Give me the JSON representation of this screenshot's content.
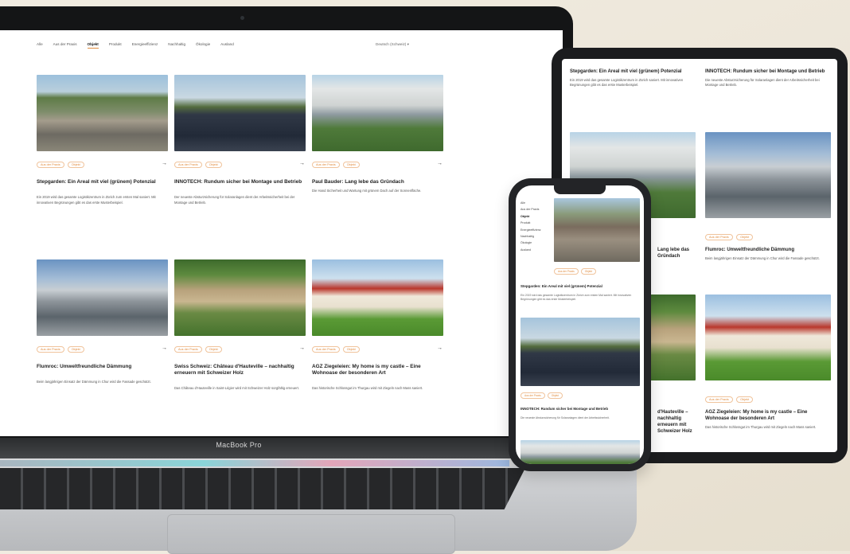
{
  "laptop": {
    "label": "MacBook Pro",
    "nav": [
      "Alle",
      "Aus der Praxis",
      "Objekt",
      "Produkt",
      "Energieeffizienz",
      "Nachhaltig",
      "Ökologie",
      "Ausland"
    ],
    "nav_active_index": 2,
    "language": "Deutsch (Schweiz) ▾",
    "cards": [
      {
        "title": "Stepgarden: Ein Areal mit viel (grünem) Potenzial",
        "text": "Ein 2019 wird das gesamte Logistikzentrum in Zürich zum ersten Mal saniert. Mit innovativen Begrünungen gibt es das erste Musterbeispiel.",
        "tags": [
          "Aus der Praxis",
          "Objekt"
        ]
      },
      {
        "title": "INNOTECH: Rundum sicher bei Montage und Betrieb",
        "text": "Der neueste Absturzsicherung für Solaranlagen dient der Arbeitssicherheit bei der Montage und Betrieb.",
        "tags": [
          "Aus der Praxis",
          "Objekt"
        ]
      },
      {
        "title": "Paul Bauder: Lang lebe das Gründach",
        "text": "Die Hand Sicherheit und Wartung mit grünem Dach auf der Sonnenfläche.",
        "tags": [
          "Aus der Praxis",
          "Objekt"
        ]
      },
      {
        "title": "Flumroc: Umweltfreundliche Dämmung",
        "text": "Beim langjährigen Einsatz der Dämmung in Chur wird die Fassade geschützt.",
        "tags": [
          "Aus der Praxis",
          "Objekt"
        ]
      },
      {
        "title": "Swiss Schweiz: Château d'Hauteville – nachhaltig erneuern mit Schweizer Holz",
        "text": "Das Château d'Hauteville in Saint-Légier wird mit Schweizer Holz sorgfältig erneuert.",
        "tags": [
          "Aus der Praxis",
          "Objekt"
        ]
      },
      {
        "title": "AGZ Ziegeleien: My home is my castle – Eine Wohnoase der besonderen Art",
        "text": "Das historische Schlossgut im Thurgau wird mit Ziegeln nach Mass saniert.",
        "tags": [
          "Aus der Praxis",
          "Objekt"
        ]
      }
    ]
  },
  "tablet": {
    "left_title": "Stepgarden: Ein Areal mit viel (grünem) Potenzial",
    "left_text": "Ein 2019 wird das gesamte Logistikzentrum in Zürich saniert. Mit innovativen Begrünungen gibt es das erste Musterbeispiel.",
    "right_title": "INNOTECH: Rundum sicher bei Montage und Betrieb",
    "right_text": "Die neueste Absturzsicherung für Solaranlagen dient der Arbeitssicherheit bei Montage und Betrieb.",
    "mid_left_title": "Lang lebe das Gründach",
    "mid_right_title": "Flumroc: Umweltfreundliche Dämmung",
    "mid_right_text": "Beim langjährigen Einsatz der Dämmung in Chur wird die Fassade geschützt.",
    "low_left_title": "d'Hauteville – nachhaltig erneuern mit Schweizer Holz",
    "low_right_title": "AGZ Ziegeleien: My home is my castle – Eine Wohnoase der besonderen Art",
    "low_right_text": "Das historische Schlossgut im Thurgau wird mit Ziegeln nach Mass saniert.",
    "tags": [
      "Aus der Praxis",
      "Objekt"
    ]
  },
  "phone": {
    "nav": [
      "Alle",
      "Aus der Praxis",
      "Objekt",
      "Produkt",
      "Energieeffizienz",
      "Nachhaltig",
      "Ökologie",
      "Ausland"
    ],
    "card1_title": "Stepgarden: Ein Areal mit viel (grünem) Potenzial",
    "card1_text": "Ein 2019 wird das gesamte Logistikzentrum in Zürich zum ersten Mal saniert. Mit innovativen Begrünungen gibt es das erste Musterbeispiel.",
    "card2_title": "INNOTECH: Rundum sicher bei Montage und Betrieb",
    "card2_text": "Die neueste Absturzsicherung für Solaranlagen dient der Arbeitssicherheit.",
    "tags": [
      "Aus der Praxis",
      "Objekt"
    ]
  },
  "colors": {
    "accent": "#e08b3e",
    "background": "#ece5d8",
    "bezel": "#141516"
  }
}
